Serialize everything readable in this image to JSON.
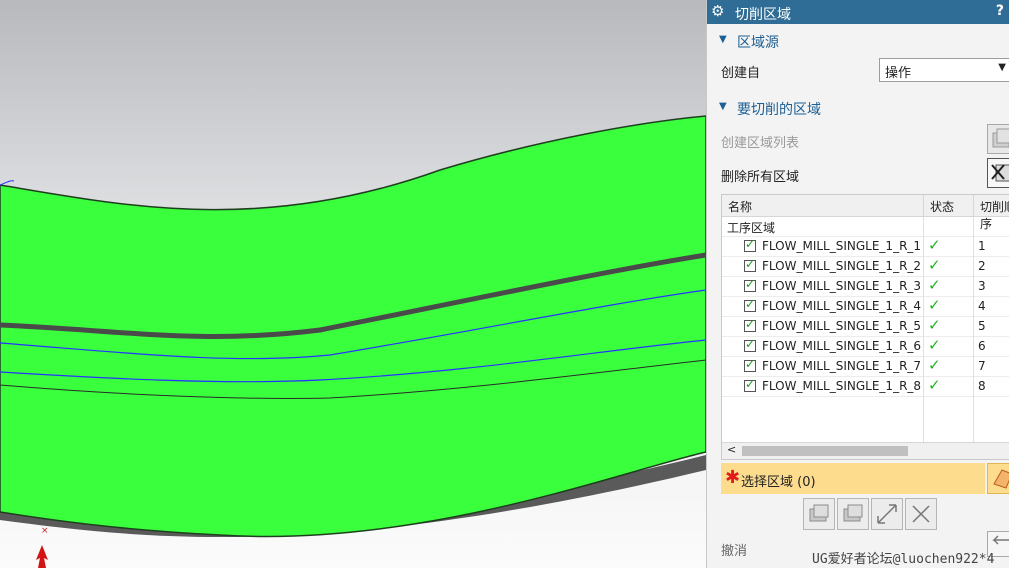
{
  "panel": {
    "title": "切削区域",
    "help_label": "?",
    "section_source": {
      "label": "区域源"
    },
    "create_from": {
      "label": "创建自",
      "value": "操作"
    },
    "section_regions": {
      "label": "要切削的区域"
    },
    "create_list_label": "创建区域列表",
    "delete_all_label": "删除所有区域",
    "table": {
      "columns": [
        "名称",
        "状态",
        "切削顺序"
      ],
      "root_label": "工序区域",
      "rows": [
        {
          "name": "FLOW_MILL_SINGLE_1_R_1",
          "order": "1"
        },
        {
          "name": "FLOW_MILL_SINGLE_1_R_2",
          "order": "2"
        },
        {
          "name": "FLOW_MILL_SINGLE_1_R_3",
          "order": "3"
        },
        {
          "name": "FLOW_MILL_SINGLE_1_R_4",
          "order": "4"
        },
        {
          "name": "FLOW_MILL_SINGLE_1_R_5",
          "order": "5"
        },
        {
          "name": "FLOW_MILL_SINGLE_1_R_6",
          "order": "6"
        },
        {
          "name": "FLOW_MILL_SINGLE_1_R_7",
          "order": "7"
        },
        {
          "name": "FLOW_MILL_SINGLE_1_R_8",
          "order": "8"
        }
      ]
    },
    "select_region": {
      "label": "选择区域 (0)"
    },
    "undo_label": "撤消"
  },
  "watermark": "UG爱好者论坛@luochen922*4",
  "colors": {
    "titlebar": "#2f6d96",
    "surface_green": "#39ff3d",
    "select_highlight": "#fddc8e",
    "toolpath_blue": "#2733ff"
  }
}
